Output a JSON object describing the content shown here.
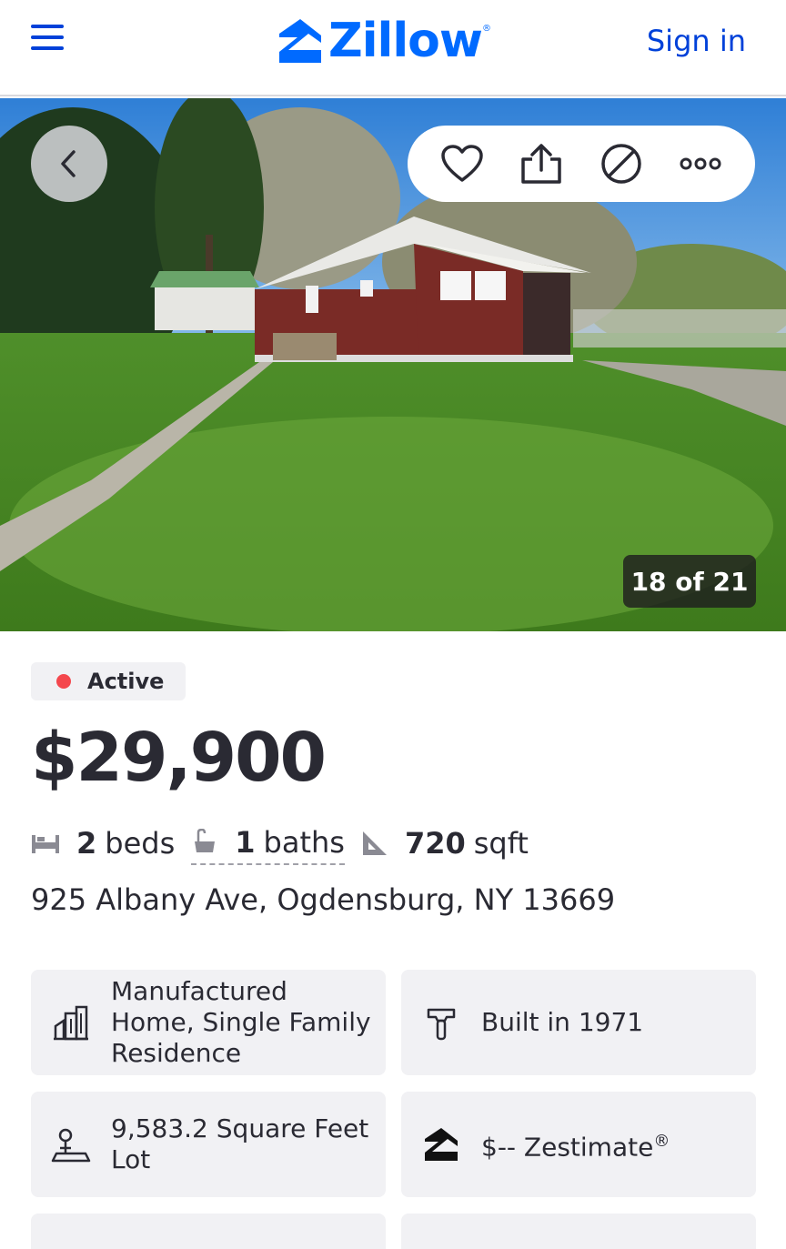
{
  "header": {
    "logo_text": "Zillow",
    "logo_mark": "®",
    "sign_in": "Sign in",
    "brand_color": "#006aff"
  },
  "photo": {
    "counter": "18 of 21",
    "actions": [
      "heart-icon",
      "share-icon",
      "hide-icon",
      "more-icon"
    ]
  },
  "listing": {
    "status": "Active",
    "status_color": "#f4474d",
    "price": "$29,900",
    "beds_value": "2",
    "beds_label": "beds",
    "baths_value": "1",
    "baths_label": "baths",
    "sqft_value": "720",
    "sqft_label": "sqft",
    "address": "925 Albany Ave, Ogdensburg, NY 13669"
  },
  "features": [
    {
      "icon": "building-icon",
      "text": "Manufactured Home, Single Family Residence"
    },
    {
      "icon": "hammer-icon",
      "text": "Built in 1971"
    },
    {
      "icon": "lot-icon",
      "text": "9,583.2 Square Feet Lot"
    },
    {
      "icon": "zestimate-icon",
      "text": "$-- Zestimate",
      "suffix": "®"
    }
  ]
}
